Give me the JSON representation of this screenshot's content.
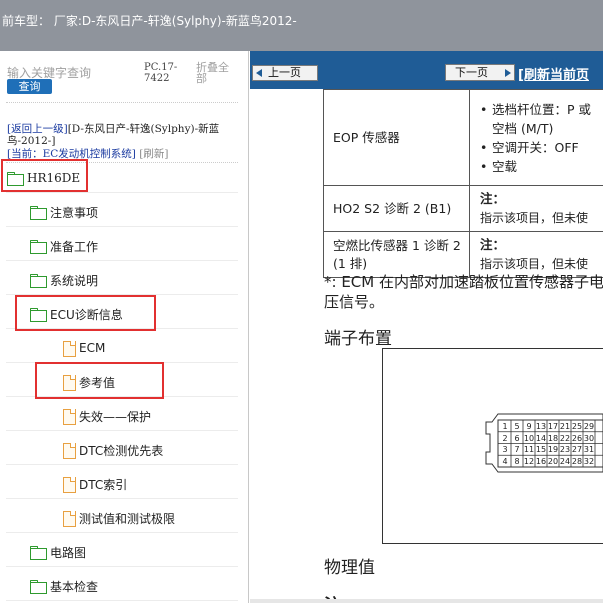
{
  "header": {
    "title": "前车型：   厂家:D-东风日产-轩逸(Sylphy)-新蓝鸟2012-"
  },
  "sidebar": {
    "search_placeholder": "输入关键字查询",
    "search_button": "查询",
    "pc_code": "PC.17-7422",
    "collapse_all": "折叠全部",
    "back_link": "[返回上一级]",
    "model_path": "[D-东风日产-轩逸(Sylphy)-新蓝鸟-2012-]",
    "current_label": "[当前：EC发动机控制系统]",
    "refresh": "[刷新]",
    "tree": [
      {
        "label": "HR16DE",
        "icon": "folder-icon"
      },
      {
        "label": "注意事项",
        "icon": "folder-icon"
      },
      {
        "label": "准备工作",
        "icon": "folder-icon"
      },
      {
        "label": "系统说明",
        "icon": "folder-icon"
      },
      {
        "label": "ECU诊断信息",
        "icon": "folder-icon"
      },
      {
        "label": "ECM",
        "icon": "document-icon"
      },
      {
        "label": "参考值",
        "icon": "document-icon"
      },
      {
        "label": "失效——保护",
        "icon": "document-icon"
      },
      {
        "label": "DTC检测优先表",
        "icon": "document-icon"
      },
      {
        "label": "DTC索引",
        "icon": "document-icon"
      },
      {
        "label": "测试值和测试极限",
        "icon": "document-icon"
      },
      {
        "label": "电路图",
        "icon": "folder-icon"
      },
      {
        "label": "基本检查",
        "icon": "folder-icon"
      }
    ]
  },
  "toolbar": {
    "prev_button": "上一页",
    "next_button": "下一页",
    "refresh_page": "[刷新当前页"
  },
  "content": {
    "table": [
      {
        "item": "EOP 传感器",
        "bullets": [
          "选档杆位置：P 或",
          "空档 (M/T)",
          "空调开关：OFF",
          "空载"
        ]
      },
      {
        "item": "HO2 S2 诊断 2 (B1)",
        "note_label": "注：",
        "note": "指示该项目，但未使"
      },
      {
        "item": "空燃比传感器 1 诊断 2 (1 排)",
        "note_label": "注：",
        "note": "指示该项目，但未使"
      }
    ],
    "footnote": "*: ECM 在内部对加速踏板位置传感器子电压信号。",
    "terminal_heading": "端子布置",
    "physical_heading": "物理值",
    "bottom_text": "注"
  },
  "colors": {
    "topbar": "#8f949c",
    "toolbar": "#1f5c96",
    "highlight_box": "#e23030",
    "folder_icon": "#2e9a2e",
    "document_icon": "#e8a040",
    "search_button": "#1f6fb8"
  }
}
